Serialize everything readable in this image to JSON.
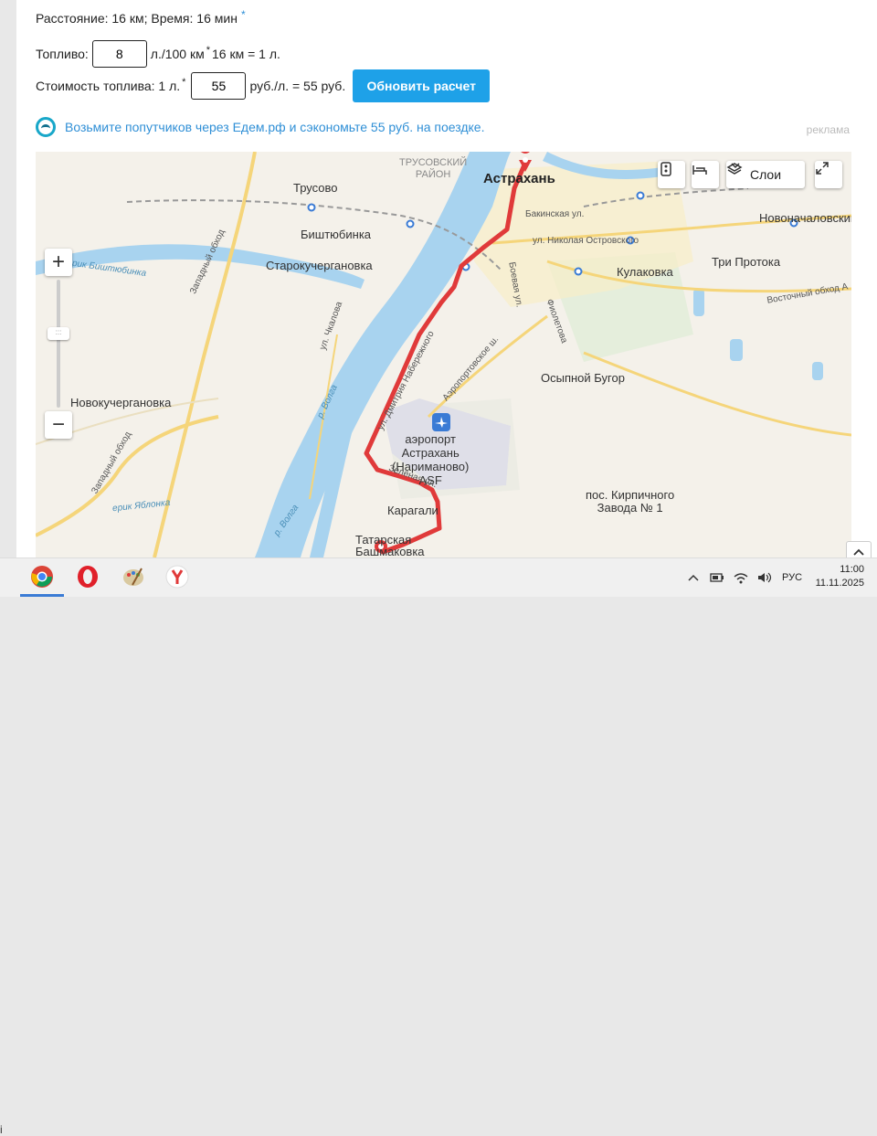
{
  "calc": {
    "distance_text": "Расстояние: 16 км; Время: 16 мин",
    "star": "*",
    "fuel_label": "Топливо:",
    "fuel_value": "8",
    "fuel_suffix_a": "л./100 км",
    "fuel_suffix_b": "16 км = 1 л.",
    "cost_label": "Стоимость топлива: 1 л.",
    "cost_value": "55",
    "cost_suffix": "руб./л. = 55 руб.",
    "update_button": "Обновить расчет"
  },
  "promo": {
    "text": "Возьмите попутчиков через Едем.рф и сэкономьте 55 руб. на поездке.",
    "ad_label": "реклама"
  },
  "map": {
    "labels": {
      "trusovsky": "ТРУСОВСКИЙ\nРАЙОН",
      "astrakhan": "Астрахань",
      "trusovo": "Трусово",
      "bishtyubinka": "Биштюбинка",
      "starokucherganovka": "Старокучергановка",
      "novonachalovsky": "Новоначаловский",
      "kulakovka": "Кулаковка",
      "tri_protoka": "Три Протока",
      "osypnoy_bugor": "Осыпной Бугор",
      "novokucherganovka": "Новокучергановка",
      "airport": "аэропорт\nАстрахань\n(Нариманово)\nASF",
      "karagali": "Карагали",
      "tatarskaya": "Татарская\nБашмаковка",
      "kirpichny": "пос. Кирпичного\nЗавода № 1",
      "bakinskaya": "Бакинская ул.",
      "ostrovskogo": "ул. Николая Островского",
      "boevaya": "Боевая ул.",
      "aeroportovskoe": "Аэропортовское ш.",
      "chkalova": "ул. Чкалова",
      "zapadny1": "Западный обход",
      "zapadny2": "Западный обход",
      "vostochny": "Восточный обход А",
      "volga1": "р. Волга",
      "volga2": "р. Волга",
      "bishtyubinka_river": "ерик Биштюбинка",
      "yablonka": "ерик Яблонка",
      "zelenaya": "Зелёная ул.",
      "nabereg": "ул. Дмитрия Набережного",
      "fiolet": "Фиолетова"
    },
    "layers_button": "Слои",
    "zoom_in": "+",
    "zoom_out": "−"
  },
  "taskbar": {
    "lang": "РУС",
    "time": "11:00",
    "date": "11.11.2025",
    "apps": [
      "chrome-icon",
      "opera-icon",
      "paint-icon",
      "yandex-browser-icon"
    ]
  },
  "colors": {
    "accent": "#1ea1e8",
    "route": "#e03a3a",
    "water": "#a8d3ef",
    "road": "#f5d57a"
  }
}
